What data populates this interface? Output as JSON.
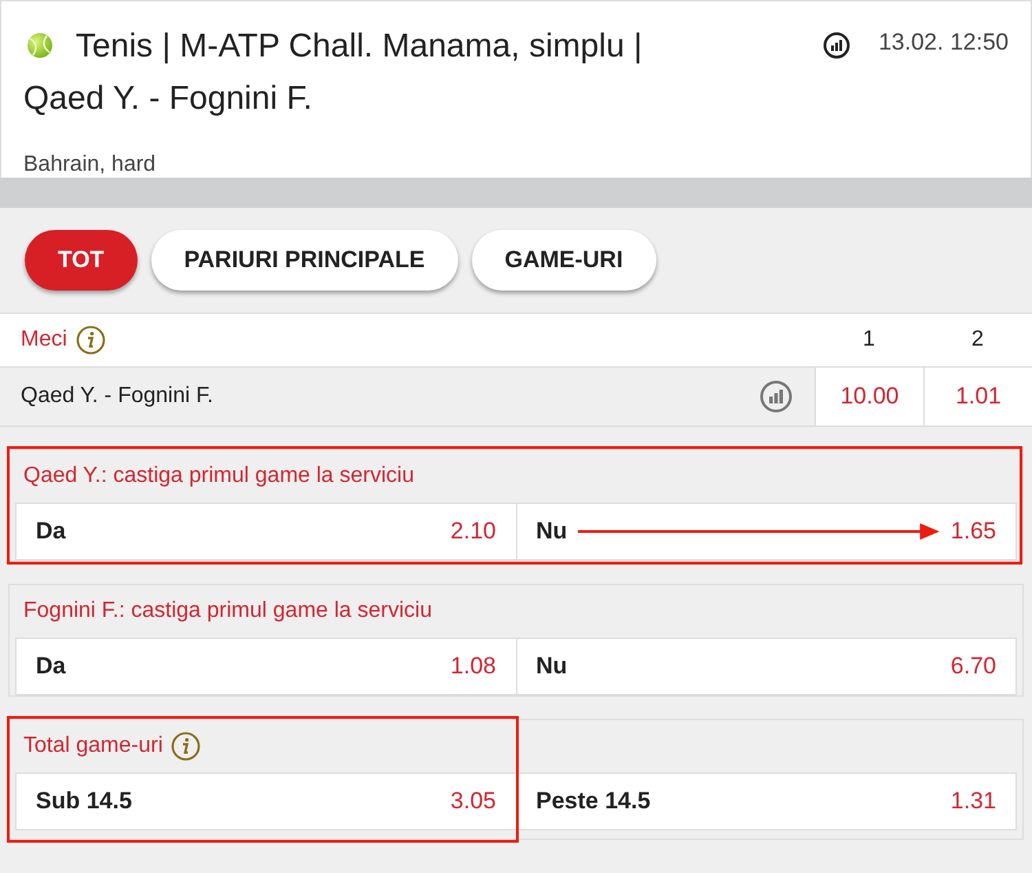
{
  "header": {
    "title": "Tenis | M-ATP Chall. Manama, simplu | Qaed Y. - Fognini F.",
    "datetime": "13.02. 12:50",
    "subtitle": "Bahrain, hard"
  },
  "tabs": [
    {
      "label": "TOT",
      "selected": true
    },
    {
      "label": "PARIURI PRINCIPALE",
      "selected": false
    },
    {
      "label": "GAME-URI",
      "selected": false
    }
  ],
  "match_table": {
    "title": "Meci",
    "columns": [
      "1",
      "2"
    ],
    "rows": [
      {
        "name": "Qaed Y. - Fognini F.",
        "odds": [
          "10.00",
          "1.01"
        ]
      }
    ]
  },
  "markets": [
    {
      "title": "Qaed Y.: castiga primul game la serviciu",
      "info": false,
      "outcomes": [
        {
          "label": "Da",
          "odds": "2.10",
          "arrow": false,
          "highlighted": true
        },
        {
          "label": "Nu",
          "odds": "1.65",
          "arrow": true,
          "highlighted": true
        }
      ]
    },
    {
      "title": "Fognini F.: castiga primul game la serviciu",
      "info": false,
      "outcomes": [
        {
          "label": "Da",
          "odds": "1.08",
          "arrow": false,
          "highlighted": false
        },
        {
          "label": "Nu",
          "odds": "6.70",
          "arrow": false,
          "highlighted": false
        }
      ]
    },
    {
      "title": "Total game-uri",
      "info": true,
      "outcomes": [
        {
          "label": "Sub 14.5",
          "odds": "3.05",
          "arrow": false,
          "highlighted": true
        },
        {
          "label": "Peste 14.5",
          "odds": "1.31",
          "arrow": false,
          "highlighted": false
        }
      ]
    }
  ]
}
